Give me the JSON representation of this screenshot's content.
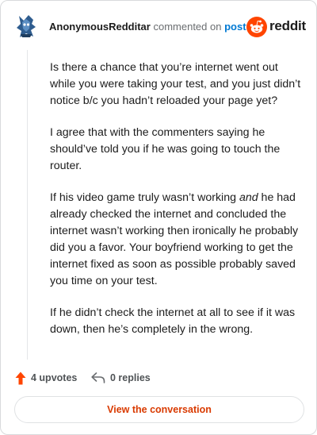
{
  "header": {
    "username": "AnonymousRedditar",
    "action": "commented on",
    "target": "post",
    "brand": "reddit"
  },
  "comment": {
    "paragraphs": [
      "Is there a chance that you’re internet went out while you were taking your test, and you just didn’t notice b/c you hadn’t reloaded your page yet?",
      "I agree that with the commenters saying he should’ve told you if he was going to touch the router.",
      [
        "If his video game truly wasn’t working ",
        "and",
        " he had already checked the internet and concluded the internet wasn’t working then ironically he probably did you a favor. Your boyfriend working to get the internet fixed as soon as possible probably saved you time on your test."
      ],
      "If he didn’t check the internet at all to see if it was down, then he’s completely in the wrong."
    ]
  },
  "footer": {
    "upvotes_label": "4 upvotes",
    "replies_label": "0 replies",
    "view_button": "View the conversation"
  },
  "colors": {
    "brand_orange": "#ff4500",
    "link_blue": "#0079d3",
    "button_text": "#d93a00"
  },
  "icons": {
    "upvote": "upvote-arrow-icon",
    "reply": "reply-arrow-icon",
    "brand": "reddit-snoo-icon",
    "avatar": "user-avatar"
  }
}
